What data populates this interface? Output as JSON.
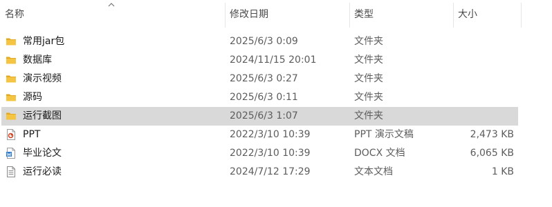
{
  "header": {
    "name_label": "名称",
    "date_label": "修改日期",
    "type_label": "类型",
    "size_label": "大小",
    "sort_icon": "chevron-up-icon"
  },
  "files": [
    {
      "name": "常用jar包",
      "date": "2025/6/3 0:09",
      "type": "文件夹",
      "size": "",
      "icon": "folder-icon",
      "selected": false
    },
    {
      "name": "数据库",
      "date": "2024/11/15 20:01",
      "type": "文件夹",
      "size": "",
      "icon": "folder-icon",
      "selected": false
    },
    {
      "name": "演示视频",
      "date": "2025/6/3 0:27",
      "type": "文件夹",
      "size": "",
      "icon": "folder-icon",
      "selected": false
    },
    {
      "name": "源码",
      "date": "2025/6/3 0:11",
      "type": "文件夹",
      "size": "",
      "icon": "folder-icon",
      "selected": false
    },
    {
      "name": "运行截图",
      "date": "2025/6/3 1:07",
      "type": "文件夹",
      "size": "",
      "icon": "folder-icon",
      "selected": true
    },
    {
      "name": "PPT",
      "date": "2022/3/10 10:39",
      "type": "PPT 演示文稿",
      "size": "2,473 KB",
      "icon": "ppt-file-icon",
      "selected": false
    },
    {
      "name": "毕业论文",
      "date": "2022/3/10 10:39",
      "type": "DOCX 文档",
      "size": "6,065 KB",
      "icon": "word-file-icon",
      "selected": false
    },
    {
      "name": "运行必读",
      "date": "2024/7/12 17:29",
      "type": "文本文档",
      "size": "1 KB",
      "icon": "text-file-icon",
      "selected": false
    }
  ],
  "colors": {
    "folder": "#f5c443",
    "folder_dark": "#e3a921",
    "ppt": "#d24726",
    "word": "#2b7cd3",
    "selected_row": "#d9d9d9"
  }
}
